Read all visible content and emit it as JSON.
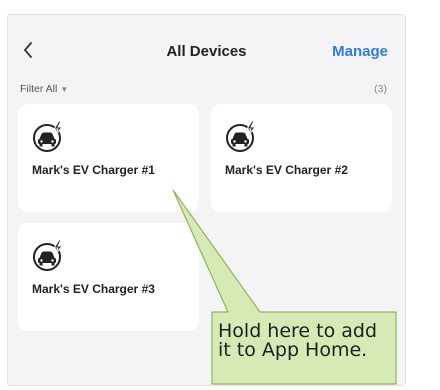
{
  "header": {
    "back_icon": "chevron-left-icon",
    "title": "All Devices",
    "manage_label": "Manage"
  },
  "filter": {
    "label": "Filter All",
    "caret_icon": "caret-down-icon",
    "count": "(3)"
  },
  "devices": [
    {
      "name": "Mark's EV Charger #1",
      "icon": "ev-charger-icon"
    },
    {
      "name": "Mark's EV Charger #2",
      "icon": "ev-charger-icon"
    },
    {
      "name": "Mark's EV Charger #3",
      "icon": "ev-charger-icon"
    }
  ],
  "callout": {
    "line1": "Hold here to add",
    "line2": "it to App Home.",
    "fill": "#d7eab6",
    "border": "#8fb359"
  }
}
